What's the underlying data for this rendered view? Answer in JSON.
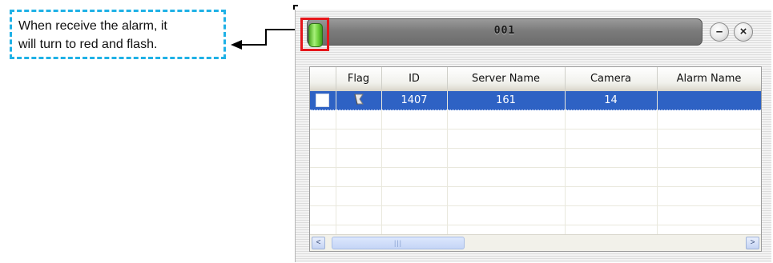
{
  "callout": {
    "text_line1": "When receive the alarm, it",
    "text_line2": "will turn to red and flash."
  },
  "window": {
    "title": "001",
    "minimize_label": "–",
    "close_label": "×",
    "alarm_indicator_state": "green"
  },
  "table": {
    "columns": [
      "",
      "Flag",
      "ID",
      "Server Name",
      "Camera",
      "Alarm Name"
    ],
    "rows": [
      {
        "checkbox": "",
        "flag": "flag-icon",
        "id": "1407",
        "server_name": "161",
        "camera": "14",
        "alarm_name": "",
        "selected": true
      }
    ],
    "empty_rows": 7
  },
  "scrollbar": {
    "left_arrow": "<",
    "right_arrow": ">",
    "thumb_grip": "|||"
  },
  "colors": {
    "callout_border": "#1fb1e6",
    "alarm_frame": "#e5161b",
    "alarm_light": "#6fd13d",
    "selected_row": "#2e62c4"
  }
}
